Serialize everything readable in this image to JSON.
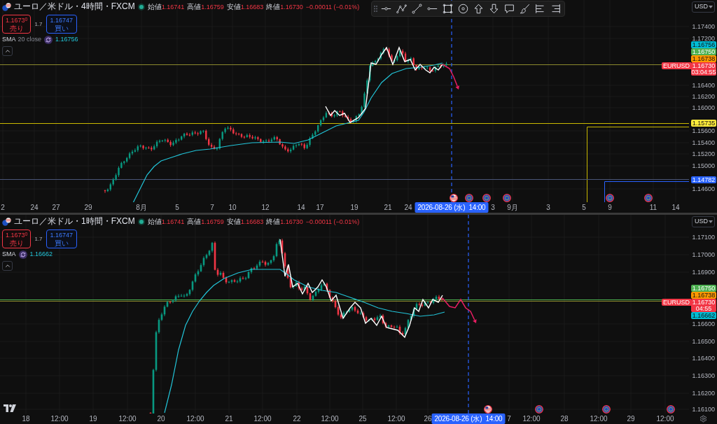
{
  "panes": [
    {
      "symbol": "ユーロ／米ドル・4時間・FXCM",
      "quote": [
        {
          "label": "始値",
          "value": "1.16741"
        },
        {
          "label": "高値",
          "value": "1.16759"
        },
        {
          "label": "安値",
          "value": "1.16683"
        },
        {
          "label": "終値",
          "value": "1.16730"
        }
      ],
      "change": "−0.00011 (−0.01%)",
      "sell": {
        "price": "1.1673$^{0}$",
        "label": "売り"
      },
      "spread": "1.7",
      "buy": {
        "price": "1.16747",
        "label": "買い"
      },
      "indicator": {
        "name": "SMA",
        "params": "20 close",
        "value": "1.16756"
      },
      "currency": "USD",
      "price_ticks": [
        "1.17400",
        "1.17200",
        "1.16400",
        "1.16200",
        "1.16000",
        "1.15600",
        "1.15400",
        "1.15200",
        "1.15000",
        "1.14600"
      ],
      "price_tags": [
        {
          "price": "1.16756",
          "color": "#00bcd4"
        },
        {
          "price": "1.16750",
          "color": "#4caf50"
        },
        {
          "price": "1.16738",
          "color": "#ff9800"
        },
        {
          "price": "1.16730",
          "color": "#f23645",
          "symbol": "EURUSD",
          "countdown": "03:04:55"
        },
        {
          "price": "1.15735",
          "color": "#ffeb3b"
        },
        {
          "price": "1.14782",
          "color": "#2962ff"
        }
      ],
      "time_labels": [
        "2",
        "24",
        "27",
        "29",
        "8月",
        "5",
        "7",
        "10",
        "12",
        "14",
        "17",
        "19",
        "21",
        "24",
        "3",
        "9月",
        "3",
        "5",
        "9",
        "11",
        "14"
      ],
      "time_cursor": "2026-08-26 (水)  14:00",
      "events": [
        {
          "kind": "us"
        },
        {
          "kind": "eu"
        },
        {
          "kind": "eu"
        },
        {
          "kind": "eu"
        },
        {
          "kind": "eu"
        },
        {
          "kind": "eu"
        }
      ]
    },
    {
      "symbol": "ユーロ／米ドル・1時間・FXCM",
      "quote": [
        {
          "label": "始値",
          "value": "1.16741"
        },
        {
          "label": "高値",
          "value": "1.16759"
        },
        {
          "label": "安値",
          "value": "1.16683"
        },
        {
          "label": "終値",
          "value": "1.16730"
        }
      ],
      "change": "−0.00011 (−0.01%)",
      "sell": {
        "price": "1.1673$^{0}$",
        "label": "売り"
      },
      "spread": "1.7",
      "buy": {
        "price": "1.16747",
        "label": "買い"
      },
      "indicator": {
        "name": "SMA",
        "value": "1.16662"
      },
      "currency": "USD",
      "price_ticks": [
        "1.17100",
        "1.17000",
        "1.16900",
        "1.16600",
        "1.16500",
        "1.16400",
        "1.16300",
        "1.16200",
        "1.16100"
      ],
      "price_tags": [
        {
          "price": "1.16750",
          "color": "#4caf50"
        },
        {
          "price": "1.16738",
          "color": "#ff9800"
        },
        {
          "price": "1.16730",
          "color": "#f23645",
          "symbol": "EURUSD",
          "countdown": "04:55"
        },
        {
          "price": "1.16662",
          "color": "#00bcd4"
        }
      ],
      "time_labels": [
        "18",
        "12:00",
        "19",
        "12:00",
        "20",
        "12:00",
        "21",
        "12:00",
        "22",
        "12:00",
        "25",
        "12:00",
        "26",
        "7",
        "12:00",
        "28",
        "12:00",
        "29",
        "12:00"
      ],
      "time_cursor": "2026-08-26 (水)  14:00",
      "events": [
        {
          "kind": "us"
        },
        {
          "kind": "eu"
        },
        {
          "kind": "eu"
        },
        {
          "kind": "eu"
        }
      ]
    }
  ]
}
